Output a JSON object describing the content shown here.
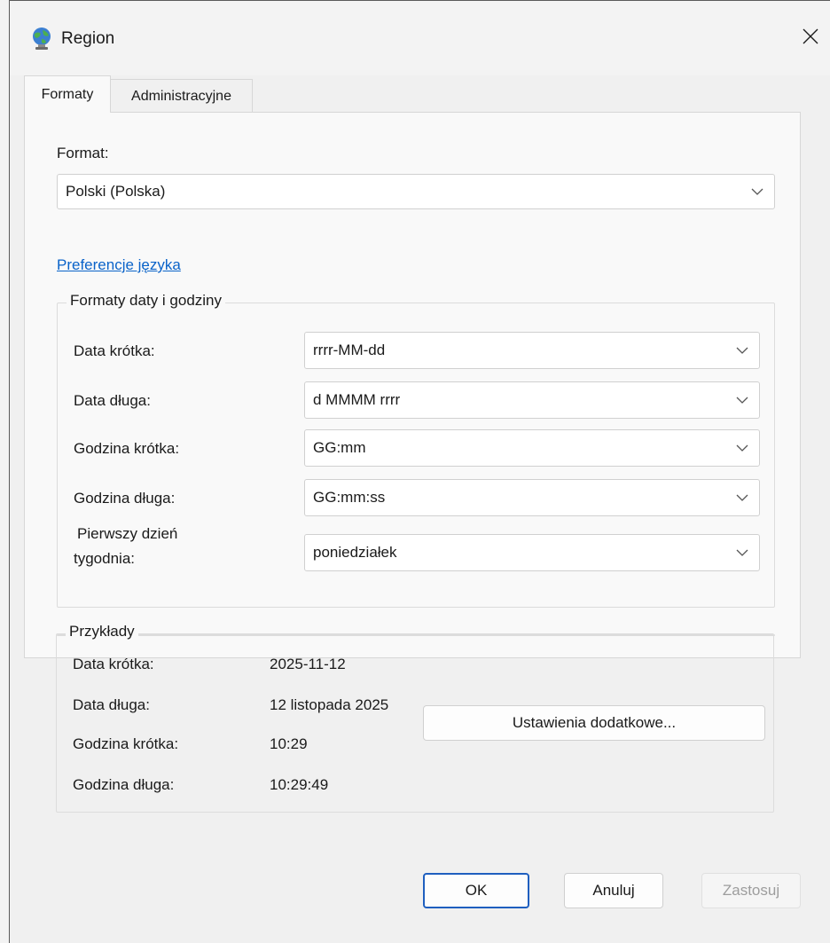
{
  "window": {
    "title": "Region",
    "close_icon": "close-icon",
    "app_icon": "globe-icon"
  },
  "tabs": [
    {
      "label": "Formaty",
      "active": true
    },
    {
      "label": "Administracyjne",
      "active": false
    }
  ],
  "format": {
    "label": "Format:",
    "value": "Polski (Polska)"
  },
  "language_link": "Preferencje językа",
  "date_time_group": {
    "legend": "Formaty daty i godziny",
    "rows": [
      {
        "label": "Data krótka:",
        "value": "rrrr-MM-dd"
      },
      {
        "label": "Data długa:",
        "value": "d MMMM rrrr"
      },
      {
        "label": "Godzina krótka:",
        "value": "GG:mm"
      },
      {
        "label": "Godzina długa:",
        "value": "GG:mm:ss"
      },
      {
        "label_line1": "Pierwszy dzień",
        "label_line2": "tygodnia:",
        "value": "poniedziałek"
      }
    ]
  },
  "examples_group": {
    "legend": "Przykłady",
    "rows": [
      {
        "label": "Data krótka:",
        "value": "2025-11-12"
      },
      {
        "label": "Data długa:",
        "value": "12 listopada 2025"
      },
      {
        "label": "Godzina krótka:",
        "value": "10:29"
      },
      {
        "label": "Godzina długa:",
        "value": "10:29:49"
      }
    ]
  },
  "additional_settings_button": "Ustawienia dodatkowe...",
  "footer_buttons": {
    "ok": "OK",
    "cancel": "Anuluj",
    "apply": "Zastosuj"
  }
}
